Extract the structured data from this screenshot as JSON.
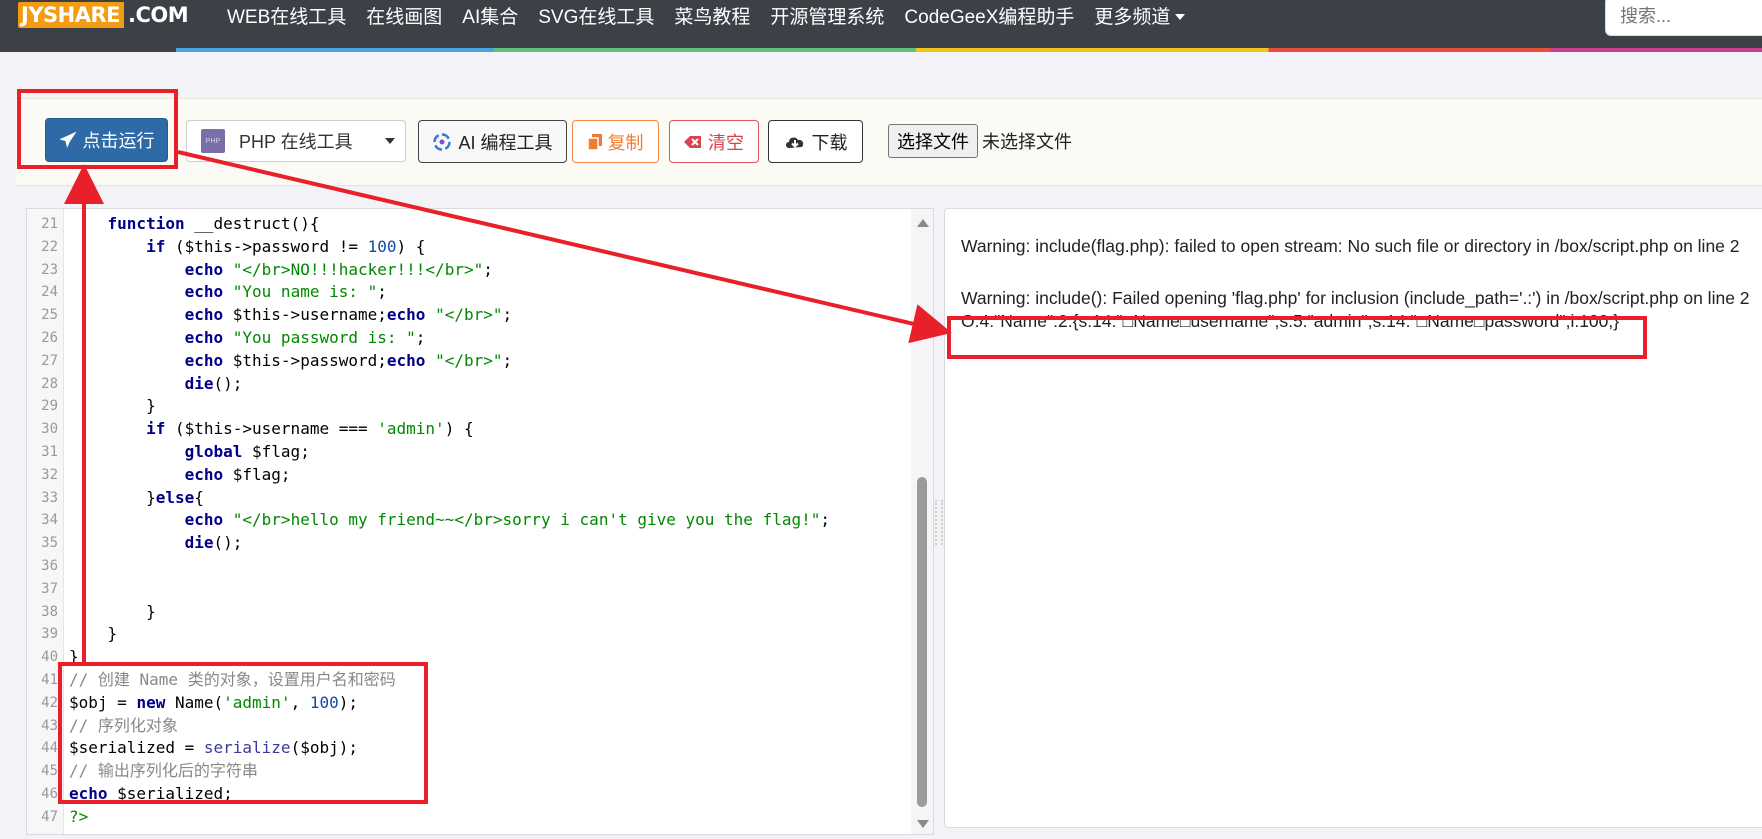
{
  "nav": {
    "logo_part1": "JYSHARE",
    "logo_part2": ".COM",
    "links": [
      "WEB在线工具",
      "在线画图",
      "AI集合",
      "SVG在线工具",
      "菜鸟教程",
      "开源管理系统",
      "CodeGeeX编程助手",
      "更多频道"
    ],
    "search_placeholder": "搜索..."
  },
  "toolbar": {
    "run_label": "点击运行",
    "language_select": "PHP 在线工具",
    "php_badge": "PHP",
    "ai_label": "AI 编程工具",
    "copy_label": "复制",
    "clear_label": "清空",
    "download_label": "下载",
    "file_button": "选择文件",
    "file_status": "未选择文件"
  },
  "editor": {
    "lines": [
      {
        "n": "21",
        "code": "    function __destruct(){"
      },
      {
        "n": "22",
        "code": "        if ($this->password != 100) {"
      },
      {
        "n": "23",
        "code": "            echo \"</br>NO!!!hacker!!!</br>\";"
      },
      {
        "n": "24",
        "code": "            echo \"You name is: \";"
      },
      {
        "n": "25",
        "code": "            echo $this->username;echo \"</br>\";"
      },
      {
        "n": "26",
        "code": "            echo \"You password is: \";"
      },
      {
        "n": "27",
        "code": "            echo $this->password;echo \"</br>\";"
      },
      {
        "n": "28",
        "code": "            die();"
      },
      {
        "n": "29",
        "code": "        }"
      },
      {
        "n": "30",
        "code": "        if ($this->username === 'admin') {"
      },
      {
        "n": "31",
        "code": "            global $flag;"
      },
      {
        "n": "32",
        "code": "            echo $flag;"
      },
      {
        "n": "33",
        "code": "        }else{"
      },
      {
        "n": "34",
        "code": "            echo \"</br>hello my friend~~</br>sorry i can't give you the flag!\";"
      },
      {
        "n": "35",
        "code": "            die();"
      },
      {
        "n": "36",
        "code": ""
      },
      {
        "n": "37",
        "code": ""
      },
      {
        "n": "38",
        "code": "        }"
      },
      {
        "n": "39",
        "code": "    }"
      },
      {
        "n": "40",
        "code": "}"
      },
      {
        "n": "41",
        "code": "// 创建 Name 类的对象，设置用户名和密码"
      },
      {
        "n": "42",
        "code": "$obj = new Name('admin', 100);"
      },
      {
        "n": "43",
        "code": "// 序列化对象"
      },
      {
        "n": "44",
        "code": "$serialized = serialize($obj);"
      },
      {
        "n": "45",
        "code": "// 输出序列化后的字符串"
      },
      {
        "n": "46",
        "code": "echo $serialized;"
      },
      {
        "n": "47",
        "code": "?>"
      }
    ]
  },
  "output": {
    "lines": [
      "Warning: include(flag.php): failed to open stream: No such file or directory in /box/script.php on line 2",
      "",
      "Warning: include(): Failed opening 'flag.php' for inclusion (include_path='.:') in /box/script.php on line 2",
      "O:4:\"Name\":2:{s:14:\"□Name□username\";s:5:\"admin\";s:14:\"□Name□password\";i:100;}"
    ]
  },
  "colors": {
    "annotation": "#e8202a",
    "run_button": "#2d6aa7",
    "nav_bg": "#3c4047",
    "logo_accent": "#f39c12"
  }
}
